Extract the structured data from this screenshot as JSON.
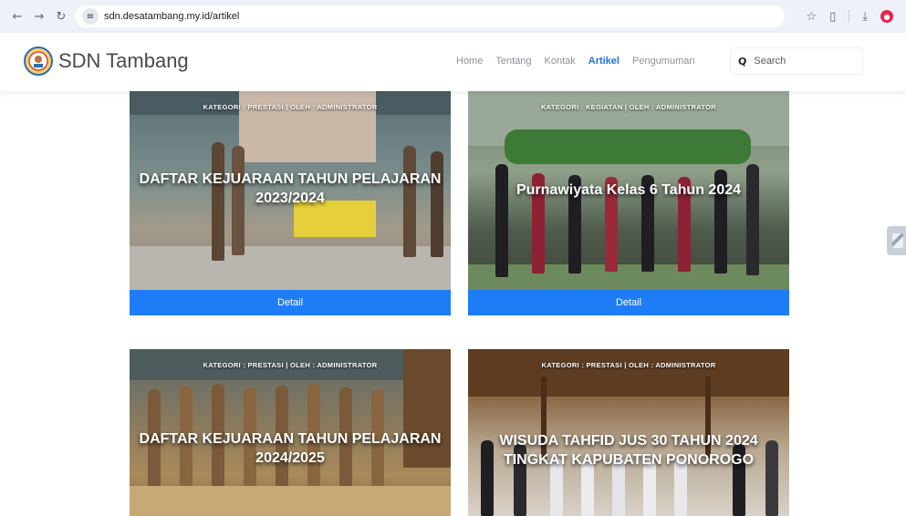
{
  "browser": {
    "url": "sdn.desatambang.my.id/artikel",
    "icons": [
      "back-icon",
      "forward-icon",
      "reload-icon",
      "site-settings-icon",
      "star-icon",
      "extensions-icon",
      "download-icon",
      "profile-icon"
    ]
  },
  "site": {
    "brand": "SDN Tambang",
    "nav": [
      "Home",
      "Tentang",
      "Kontak",
      "Artikel",
      "Pengumuman"
    ],
    "active_nav": "Artikel",
    "search_placeholder": "Search"
  },
  "articles": [
    {
      "meta": "KATEGORI : PRESTASI | OLEH : ADMINISTRATOR",
      "title": "DAFTAR KEJUARAAN TAHUN PELAJARAN 2023/2024",
      "button": "Detail"
    },
    {
      "meta": "KATEGORI : KEGIATAN | OLEH : ADMINISTRATOR",
      "title": "Purnawiyata Kelas 6 Tahun 2024",
      "button": "Detail"
    },
    {
      "meta": "KATEGORI : PRESTASI | OLEH : ADMINISTRATOR",
      "title": "DAFTAR KEJUARAAN TAHUN PELAJARAN 2024/2025"
    },
    {
      "meta": "KATEGORI : PRESTASI | OLEH : ADMINISTRATOR",
      "title": "WISUDA TAHFID JUS 30 TAHUN 2024 TINGKAT KAPUBATEN PONOROGO"
    }
  ],
  "colors": {
    "accent": "#1e7df6",
    "active_nav": "#1a73e8"
  }
}
